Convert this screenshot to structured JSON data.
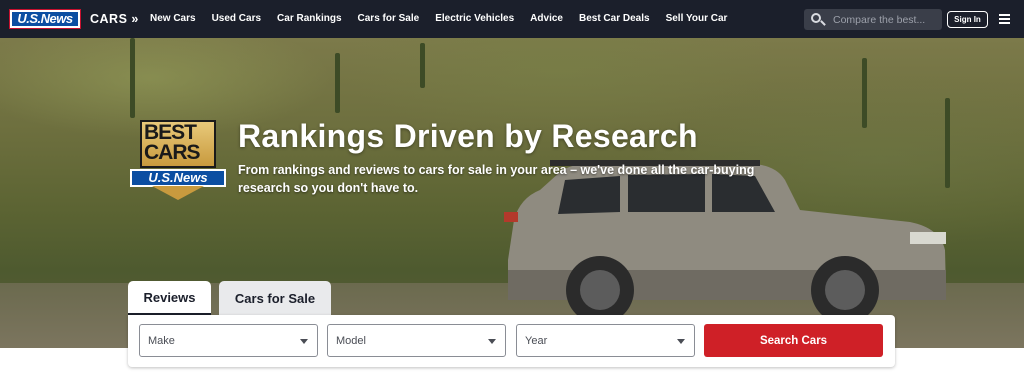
{
  "nav": {
    "logo_text": "U.S.News",
    "section_label": "CARS »",
    "links": [
      "New Cars",
      "Used Cars",
      "Car Rankings",
      "Cars for Sale",
      "Electric Vehicles",
      "Advice",
      "Best Car Deals",
      "Sell Your Car"
    ],
    "search_placeholder": "Compare the best...",
    "signin_label": "Sign In",
    "icons": {
      "search": "search-icon",
      "menu": "hamburger-menu-icon"
    }
  },
  "hero": {
    "badge": {
      "top_line": "BEST",
      "bottom_line": "CARS",
      "band_text": "U.S.News"
    },
    "title": "Rankings Driven by Research",
    "subtitle": "From rankings and reviews to cars for sale in your area – we've done all the car-buying research so you don't have to."
  },
  "search_panel": {
    "tabs": [
      {
        "label": "Reviews",
        "active": true
      },
      {
        "label": "Cars for Sale",
        "active": false
      }
    ],
    "make_label": "Make",
    "model_label": "Model",
    "year_label": "Year",
    "button_label": "Search Cars"
  },
  "colors": {
    "nav_bg": "#1b1f2b",
    "brand_blue": "#0b4ea2",
    "button_red": "#cf2027",
    "badge_gold": "#c89a3e"
  }
}
